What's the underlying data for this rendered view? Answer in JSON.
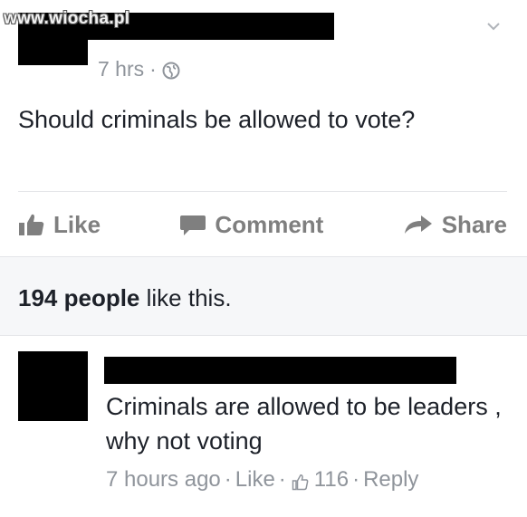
{
  "watermark": "www.wiocha.pl",
  "post": {
    "time": "7 hrs",
    "separator": "·",
    "audience_icon": "globe-icon",
    "text": "Should criminals be allowed to vote?"
  },
  "actions": {
    "like_label": "Like",
    "comment_label": "Comment",
    "share_label": "Share"
  },
  "likes": {
    "count_text": "194 people",
    "suffix_text": " like this."
  },
  "comment": {
    "text": "Criminals are allowed to be leaders , why not voting",
    "time": "7 hours ago",
    "sep1": "·",
    "like_label": "Like",
    "sep2": "·",
    "like_count": "116",
    "sep3": "·",
    "reply_label": "Reply"
  },
  "colors": {
    "text": "#1d2129",
    "muted": "#8f949b",
    "action": "#7f7f7f",
    "panel": "#f6f7f9",
    "divider": "#e5e6e9"
  }
}
